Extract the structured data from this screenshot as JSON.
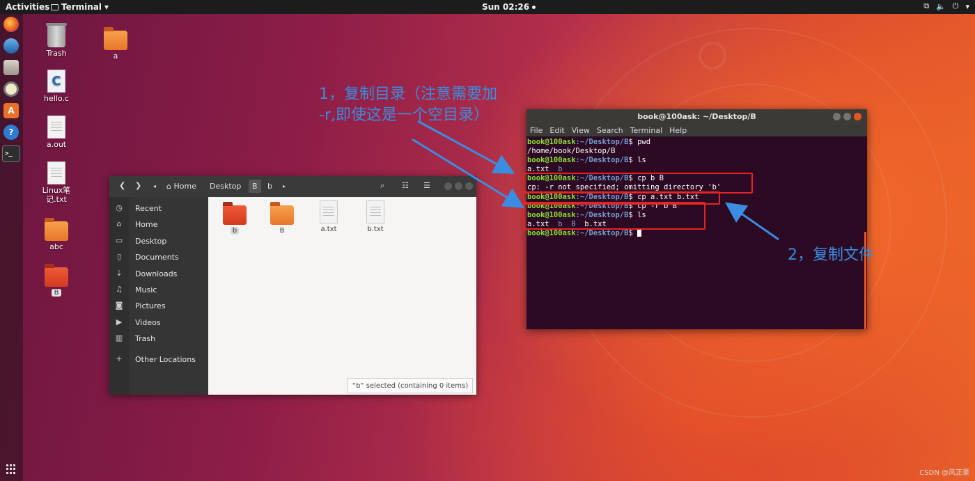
{
  "topbar": {
    "activities": "Activities",
    "app_menu": "Terminal",
    "clock": "Sun 02:26"
  },
  "dock": {
    "items": [
      {
        "name": "firefox-icon"
      },
      {
        "name": "thunderbird-icon"
      },
      {
        "name": "files-icon"
      },
      {
        "name": "rhythmbox-icon"
      },
      {
        "name": "software-icon"
      },
      {
        "name": "help-icon"
      },
      {
        "name": "terminal-icon"
      }
    ]
  },
  "desktop": {
    "icons": {
      "trash": "Trash",
      "a": "a",
      "hello": "hello.c",
      "aout": "a.out",
      "linux_notes": "Linux笔记.txt",
      "abc": "abc",
      "B": "B"
    }
  },
  "file_manager": {
    "breadcrumb": {
      "home": "Home",
      "desktop": "Desktop",
      "current": "B",
      "child": "b"
    },
    "sidebar": [
      {
        "label": "Recent",
        "icon": "clock"
      },
      {
        "label": "Home",
        "icon": "home"
      },
      {
        "label": "Desktop",
        "icon": "folder"
      },
      {
        "label": "Documents",
        "icon": "document"
      },
      {
        "label": "Downloads",
        "icon": "download"
      },
      {
        "label": "Music",
        "icon": "music"
      },
      {
        "label": "Pictures",
        "icon": "camera"
      },
      {
        "label": "Videos",
        "icon": "video"
      },
      {
        "label": "Trash",
        "icon": "trash"
      },
      {
        "label": "Other Locations",
        "icon": "plus"
      }
    ],
    "files": [
      {
        "name": "b",
        "type": "folder"
      },
      {
        "name": "B",
        "type": "folder"
      },
      {
        "name": "a.txt",
        "type": "text"
      },
      {
        "name": "b.txt",
        "type": "text"
      }
    ],
    "status": "“b” selected  (containing 0 items)"
  },
  "terminal": {
    "title": "book@100ask: ~/Desktop/B",
    "menu": [
      "File",
      "Edit",
      "View",
      "Search",
      "Terminal",
      "Help"
    ],
    "prompt_user": "book@100ask",
    "prompt_path": ":~/Desktop/B",
    "prompt_end": "$ ",
    "lines": [
      {
        "kind": "cmd",
        "text": "pwd"
      },
      {
        "kind": "out",
        "text": "/home/book/Desktop/B"
      },
      {
        "kind": "cmd",
        "text": "ls"
      },
      {
        "kind": "ls",
        "items": [
          "a.txt",
          "b"
        ]
      },
      {
        "kind": "cmd",
        "text": "cp b B"
      },
      {
        "kind": "out",
        "text": "cp: -r not specified; omitting directory 'b'"
      },
      {
        "kind": "cmd",
        "text": "cp a.txt b.txt"
      },
      {
        "kind": "cmd",
        "text": "cp -r b B"
      },
      {
        "kind": "cmd",
        "text": "ls"
      },
      {
        "kind": "ls",
        "items": [
          "a.txt",
          "b",
          "B",
          "b.txt"
        ]
      },
      {
        "kind": "prompt",
        "text": ""
      }
    ]
  },
  "annotations": {
    "note1_line1": "1，复制目录（注意需要加",
    "note1_line2": "-r,即使这是一个空目录）",
    "note2": "2，复制文件",
    "color": "#3a8de0",
    "box_color": "#e52424"
  },
  "watermark": "CSDN @风正豪"
}
